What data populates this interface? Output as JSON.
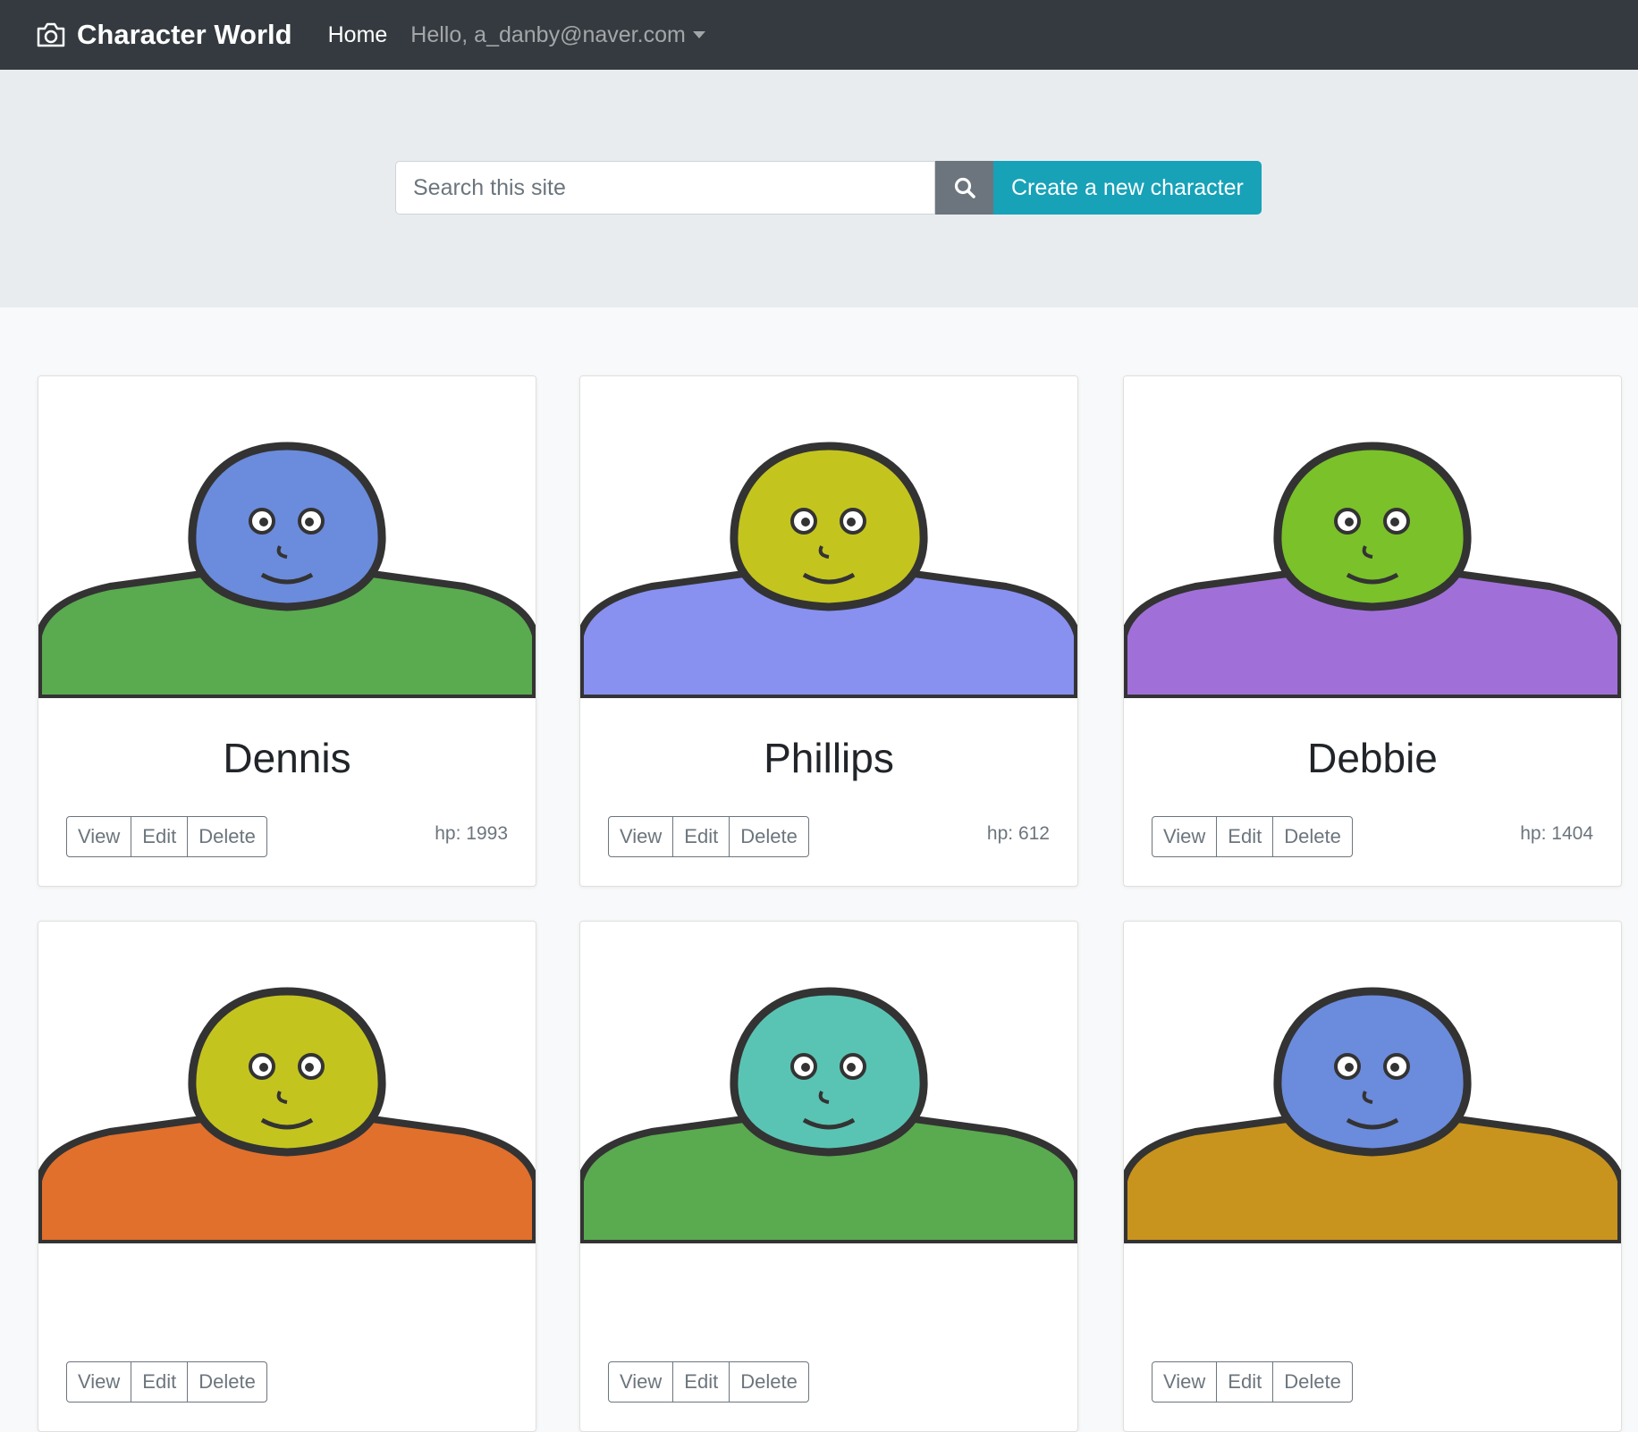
{
  "navbar": {
    "brand": "Character World",
    "home": "Home",
    "user": "Hello, a_danby@naver.com"
  },
  "search": {
    "placeholder": "Search this site",
    "create_label": "Create a new character"
  },
  "actions": {
    "view": "View",
    "edit": "Edit",
    "delete": "Delete"
  },
  "characters": [
    {
      "name": "Dennis",
      "hp": "hp: 1993",
      "skin": "#6b8bdc",
      "body": "#5aaa50"
    },
    {
      "name": "Phillips",
      "hp": "hp: 612",
      "skin": "#c4c41f",
      "body": "#8890f0"
    },
    {
      "name": "Debbie",
      "hp": "hp: 1404",
      "skin": "#7ac12a",
      "body": "#a070d8"
    },
    {
      "name": "",
      "hp": "",
      "skin": "#c4c41f",
      "body": "#e0702c"
    },
    {
      "name": "",
      "hp": "",
      "skin": "#5ac4b4",
      "body": "#5aaa50"
    },
    {
      "name": "",
      "hp": "",
      "skin": "#6b8bdc",
      "body": "#c8941e"
    }
  ]
}
